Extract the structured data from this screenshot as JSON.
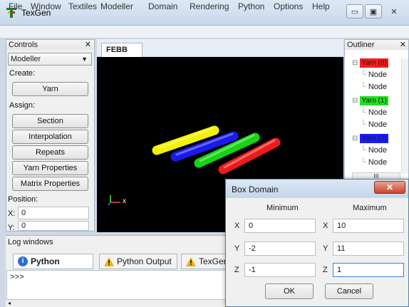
{
  "app": {
    "title": "TexGen"
  },
  "window_buttons": {
    "minimize": "▭",
    "maximize": "▣",
    "close": "✕"
  },
  "menu": [
    "File",
    "Window",
    "Textiles",
    "Modeller",
    "Domain",
    "Rendering",
    "Python",
    "Options",
    "Help"
  ],
  "controls": {
    "header": "Controls",
    "close": "✕",
    "mode_select": "Modeller",
    "create_label": "Create:",
    "yarn_button": "Yarn",
    "assign_label": "Assign:",
    "assign_buttons": [
      "Section",
      "Interpolation",
      "Repeats",
      "Yarn Properties",
      "Matrix Properties"
    ],
    "position_label": "Position:",
    "position": {
      "x_label": "X:",
      "x_value": "0",
      "y_label": "Y:",
      "y_value": "0"
    }
  },
  "viewport": {
    "tab_label": "FEBB",
    "tab_close": "✕",
    "axis_label": "x"
  },
  "yarn_colors": [
    "#f2f200",
    "#1a1aee",
    "#14d414",
    "#ee1a1a"
  ],
  "outliner": {
    "header": "Outliner",
    "close": "✕",
    "yarns": [
      {
        "label": "Yarn (0)",
        "color": "#ff1a1a",
        "nodes": [
          "Node",
          "Node"
        ]
      },
      {
        "label": "Yarn (1)",
        "color": "#22e022",
        "nodes": [
          "Node",
          "Node"
        ]
      },
      {
        "label": "Yarn (2)",
        "color": "#1a1aff",
        "nodes": [
          "Node",
          "Node"
        ]
      }
    ],
    "scroll_label": "III"
  },
  "log": {
    "header": "Log windows",
    "tabs": [
      "Python Console",
      "Python Output",
      "TexGen O"
    ],
    "prompt": ">>>"
  },
  "dialog": {
    "title": "Box Domain",
    "close": "✕",
    "min_header": "Minimum",
    "max_header": "Maximum",
    "rows": [
      {
        "axis": "X",
        "min": "0",
        "max": "10"
      },
      {
        "axis": "Y",
        "min": "-2",
        "max": "11"
      },
      {
        "axis": "Z",
        "min": "-1",
        "max": "1"
      }
    ],
    "ok_label": "OK",
    "cancel_label": "Cancel"
  }
}
